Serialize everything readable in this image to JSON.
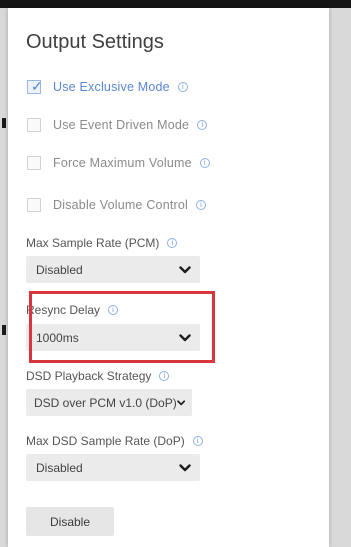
{
  "panel": {
    "title": "Output Settings"
  },
  "checkboxes": [
    {
      "label": "Use Exclusive Mode",
      "checked": true
    },
    {
      "label": "Use Event Driven Mode",
      "checked": false
    },
    {
      "label": "Force Maximum Volume",
      "checked": false
    },
    {
      "label": "Disable Volume Control",
      "checked": false
    }
  ],
  "fields": {
    "max_sample_rate": {
      "label": "Max Sample Rate (PCM)",
      "value": "Disabled"
    },
    "resync_delay": {
      "label": "Resync Delay",
      "value": "1000ms"
    },
    "dsd_playback": {
      "label": "DSD Playback Strategy",
      "value": "DSD over PCM v1.0 (DoP)"
    },
    "max_dsd_rate": {
      "label": "Max DSD Sample Rate (DoP)",
      "value": "Disabled"
    }
  },
  "actions": {
    "disable_label": "Disable"
  },
  "icons": {
    "info": "info-icon",
    "check": "checkmark-icon",
    "dropdown": "chevron-down-icon"
  },
  "colors": {
    "accent": "#5a86d6",
    "highlight": "#d8363a",
    "select_bg": "#ebebeb"
  }
}
